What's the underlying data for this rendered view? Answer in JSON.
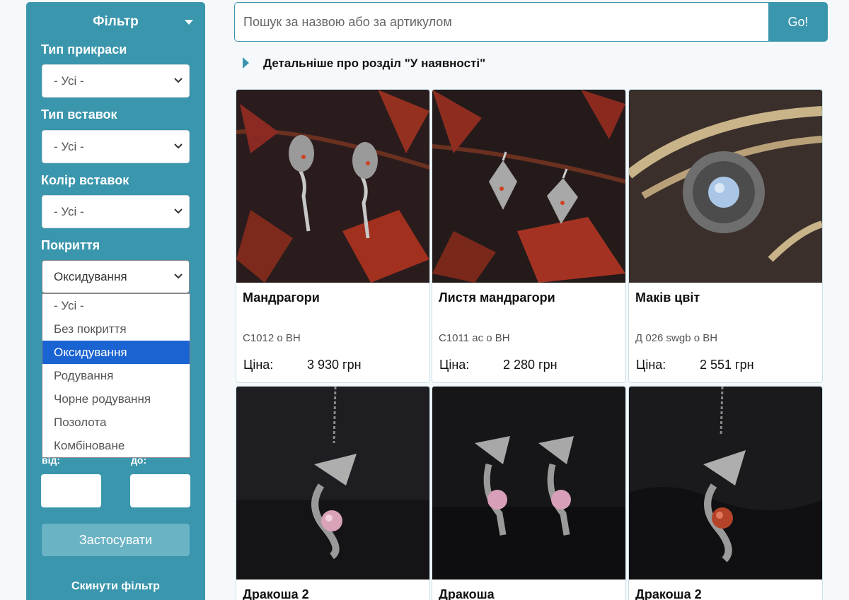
{
  "search": {
    "placeholder": "Пошук за назвою або за артикулом",
    "button": "Go!"
  },
  "section_link": "Детальніше про розділ \"У наявності\"",
  "filter": {
    "title": "Фільтр",
    "fields": [
      {
        "label": "Тип прикраси",
        "value": "- Усі -"
      },
      {
        "label": "Тип вставок",
        "value": "- Усі -"
      },
      {
        "label": "Колір вставок",
        "value": "- Усі -"
      },
      {
        "label": "Покриття",
        "value": "Оксидування"
      }
    ],
    "coating_options": [
      "- Усі -",
      "Без покриття",
      "Оксидування",
      "Родування",
      "Чорне родування",
      "Позолота",
      "Комбіноване"
    ],
    "coating_selected": "Оксидування",
    "price_from_label": "від:",
    "price_to_label": "до:",
    "apply": "Застосувати",
    "reset": "Скинути фільтр"
  },
  "products": [
    {
      "name": "Мандрагори",
      "sku": "С1012 о ВН",
      "price_label": "Ціна:",
      "price": "3 930 грн",
      "image": "leaf-dragon-earrings"
    },
    {
      "name": "Листя мандрагори",
      "sku": "С1011 ас о ВН",
      "price_label": "Ціна:",
      "price": "2 280 грн",
      "image": "leaf-earrings"
    },
    {
      "name": "Маків цвіт",
      "sku": "Д 026 swgb о ВН",
      "price_label": "Ціна:",
      "price": "2 551 грн",
      "image": "poppy-pendant"
    },
    {
      "name": "Дракоша 2",
      "sku": "",
      "price_label": "",
      "price": "",
      "image": "dragon-pendant-pink"
    },
    {
      "name": "Дракоша",
      "sku": "",
      "price_label": "",
      "price": "",
      "image": "dragon-earrings-pink"
    },
    {
      "name": "Дракоша 2",
      "sku": "",
      "price_label": "",
      "price": "",
      "image": "dragon-pendant-red"
    }
  ],
  "colors": {
    "accent": "#3a96ad",
    "selected_option": "#1a63d2",
    "apply_button": "#6ab3c4"
  }
}
